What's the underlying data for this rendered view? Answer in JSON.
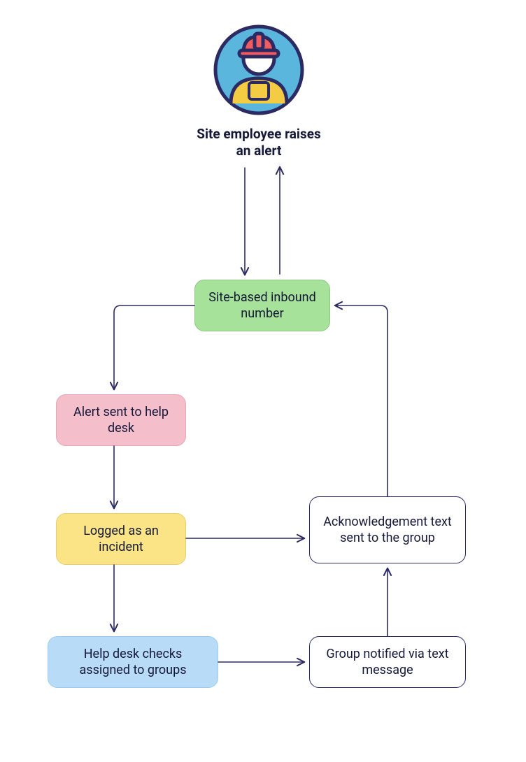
{
  "title": "Site employee raises an alert",
  "nodes": {
    "inbound": {
      "label": "Site-based inbound number"
    },
    "alert": {
      "label": "Alert sent to help desk"
    },
    "logged": {
      "label": "Logged as an incident"
    },
    "helpdesk": {
      "label": "Help desk checks assigned to groups"
    },
    "notified": {
      "label": "Group notified via text message"
    },
    "ack": {
      "label": "Acknowledgement text sent to the group"
    }
  },
  "colors": {
    "stroke": "#2B2A63",
    "iconCircleFill": "#5BB6DE",
    "iconCircleStroke": "#2B2A63",
    "hardhatFill": "#F05C60",
    "overallsFill": "#F4CC44",
    "faceFill": "#FFFFFF"
  }
}
